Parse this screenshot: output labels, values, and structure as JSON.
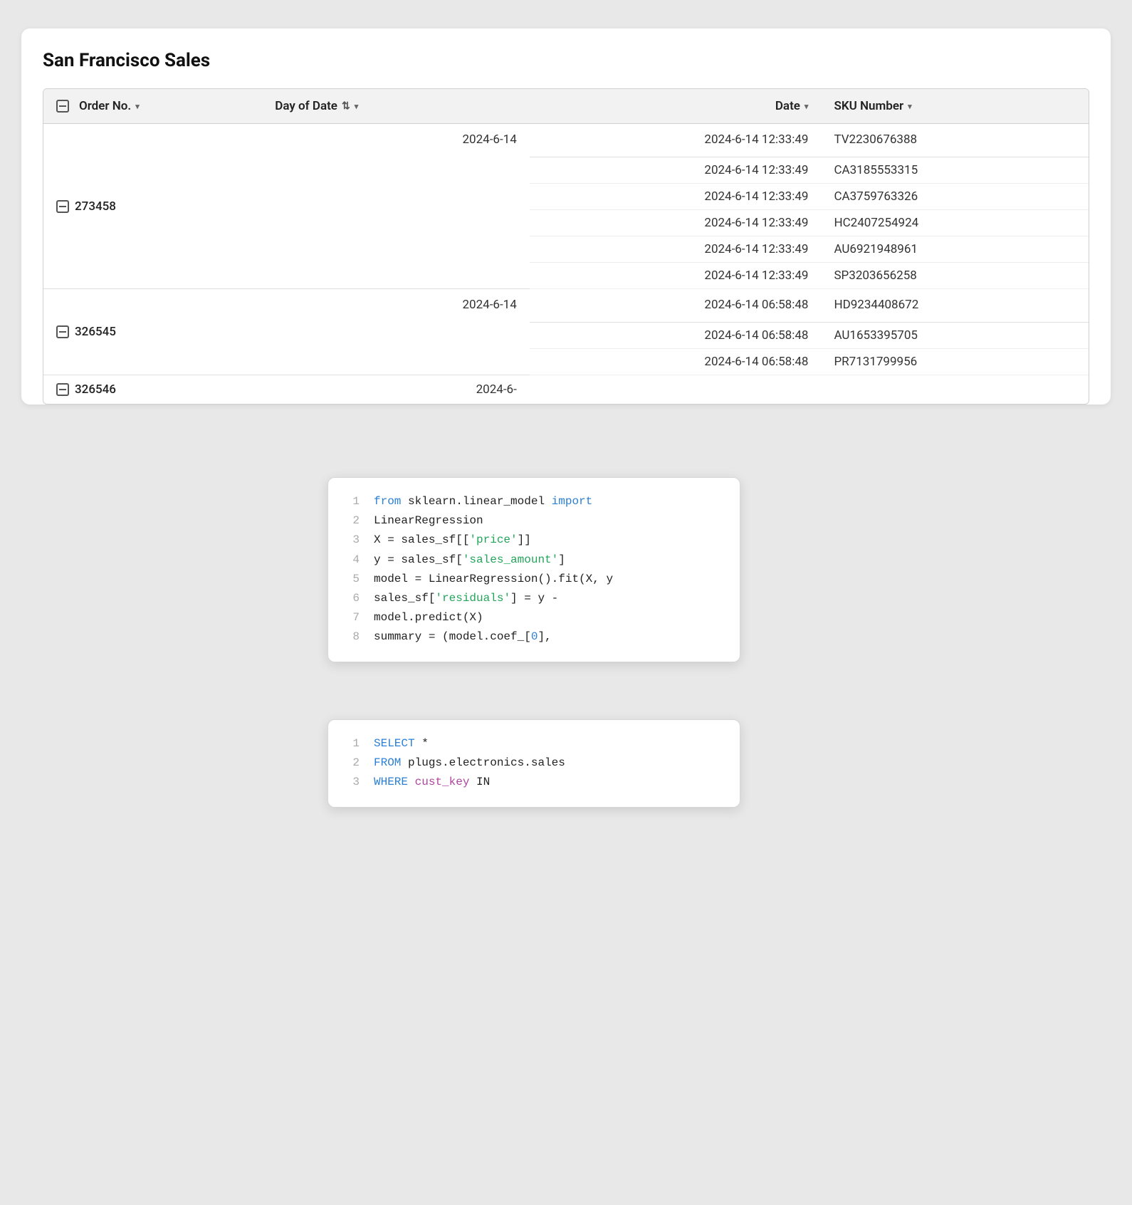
{
  "page": {
    "title": "San Francisco Sales"
  },
  "table": {
    "columns": [
      {
        "id": "order",
        "label": "Order No.",
        "icon": "minus-expand",
        "sort": "dropdown"
      },
      {
        "id": "day",
        "label": "Day of Date",
        "icon": "filter-sort",
        "sort": "dropdown"
      },
      {
        "id": "date",
        "label": "Date",
        "sort": "dropdown"
      },
      {
        "id": "sku",
        "label": "SKU Number",
        "sort": "dropdown"
      }
    ],
    "groups": [
      {
        "order_no": "273458",
        "day_of_date": "2024-6-14",
        "rows": [
          {
            "date": "2024-6-14 12:33:49",
            "sku": "TV2230676388"
          },
          {
            "date": "2024-6-14 12:33:49",
            "sku": "CA3185553315"
          },
          {
            "date": "2024-6-14 12:33:49",
            "sku": "CA3759763326"
          },
          {
            "date": "2024-6-14 12:33:49",
            "sku": "HC2407254924"
          },
          {
            "date": "2024-6-14 12:33:49",
            "sku": "AU6921948961"
          },
          {
            "date": "2024-6-14 12:33:49",
            "sku": "SP3203656258"
          }
        ]
      },
      {
        "order_no": "326545",
        "day_of_date": "2024-6-14",
        "rows": [
          {
            "date": "2024-6-14 06:58:48",
            "sku": "HD9234408672"
          },
          {
            "date": "2024-6-14 06:58:48",
            "sku": "AU1653395705"
          },
          {
            "date": "2024-6-14 06:58:48",
            "sku": "PR7131799956"
          }
        ]
      },
      {
        "order_no": "326546",
        "day_of_date": "2024-6-",
        "rows": []
      }
    ]
  },
  "code_block_1": {
    "lines": [
      {
        "num": 1,
        "text": "from sklearn.linear_model import"
      },
      {
        "num": 2,
        "text": "LinearRegression"
      },
      {
        "num": 3,
        "text": "X = sales_sf[['price']]"
      },
      {
        "num": 4,
        "text": "y = sales_sf['sales_amount']"
      },
      {
        "num": 5,
        "text": "model = LinearRegression().fit(X, y"
      },
      {
        "num": 6,
        "text": "sales_sf['residuals'] = y -"
      },
      {
        "num": 7,
        "text": "model.predict(X)"
      },
      {
        "num": 8,
        "text": "summary = (model.coef_[0],"
      }
    ]
  },
  "code_block_2": {
    "lines": [
      {
        "num": 1,
        "text": "SELECT *"
      },
      {
        "num": 2,
        "text": "FROM plugs.electronics.sales"
      },
      {
        "num": 3,
        "text": "WHERE cust_key IN"
      }
    ]
  },
  "icons": {
    "minus": "−",
    "dropdown": "▾",
    "filter_sort": "⇅"
  }
}
